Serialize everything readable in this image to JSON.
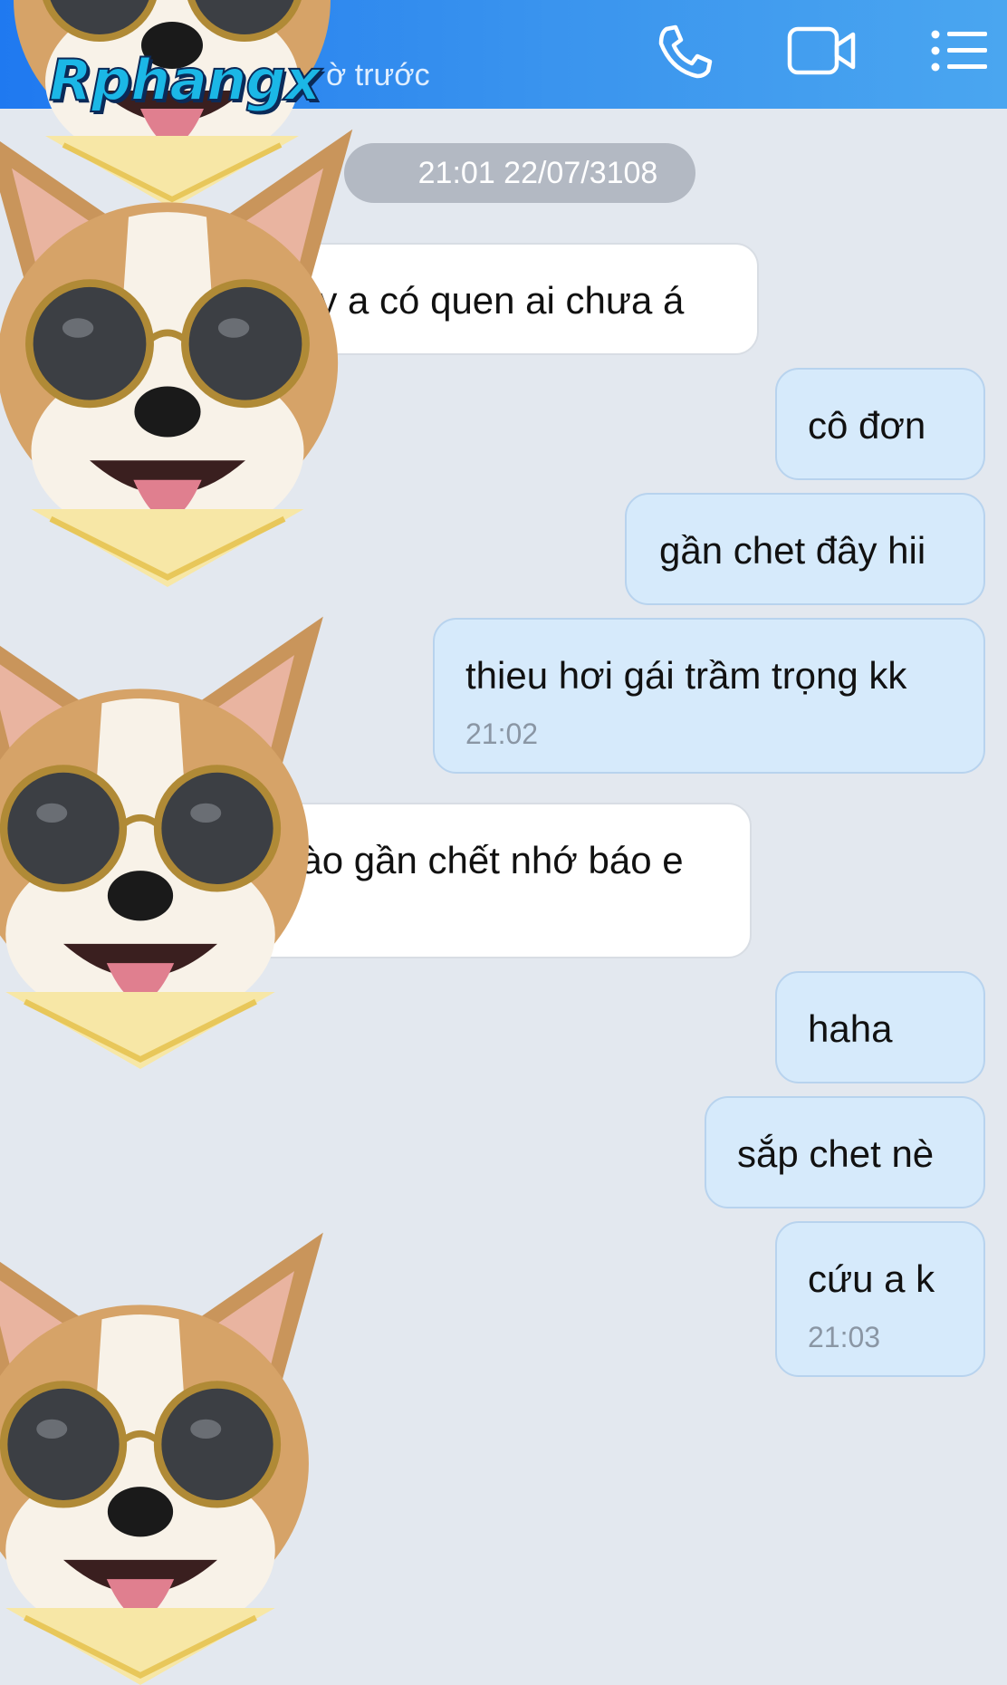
{
  "header": {
    "status": "Vừa truy cập 1 giờ trước",
    "status_visible": "ờ trước",
    "icons": [
      "phone-icon",
      "video-call-icon",
      "menu-list-icon"
    ],
    "accent": "#2a88f0"
  },
  "watermark": {
    "text": "Rphangx"
  },
  "conversation": {
    "timestamp_pill": "21:01 22/07/3108",
    "messages": [
      {
        "side": "incoming",
        "text": "ay a có quen ai chưa á"
      },
      {
        "side": "outgoing",
        "text": "cô đơn"
      },
      {
        "side": "outgoing",
        "text": "gần chet đây hii"
      },
      {
        "side": "outgoing",
        "text": "thieu hơi gái trầm trọng kk",
        "time": "21:02"
      },
      {
        "side": "incoming",
        "text": "g nào gần chết nhớ báo e"
      },
      {
        "side": "outgoing",
        "text": "haha"
      },
      {
        "side": "outgoing",
        "text": "sắp chet nè"
      },
      {
        "side": "outgoing",
        "text": "cứu a k",
        "time": "21:03"
      }
    ]
  },
  "colors": {
    "background": "#e3e8ef",
    "outgoing_bubble": "#d6eafb",
    "incoming_bubble": "#ffffff",
    "time_pill": "#b3b9c3"
  }
}
